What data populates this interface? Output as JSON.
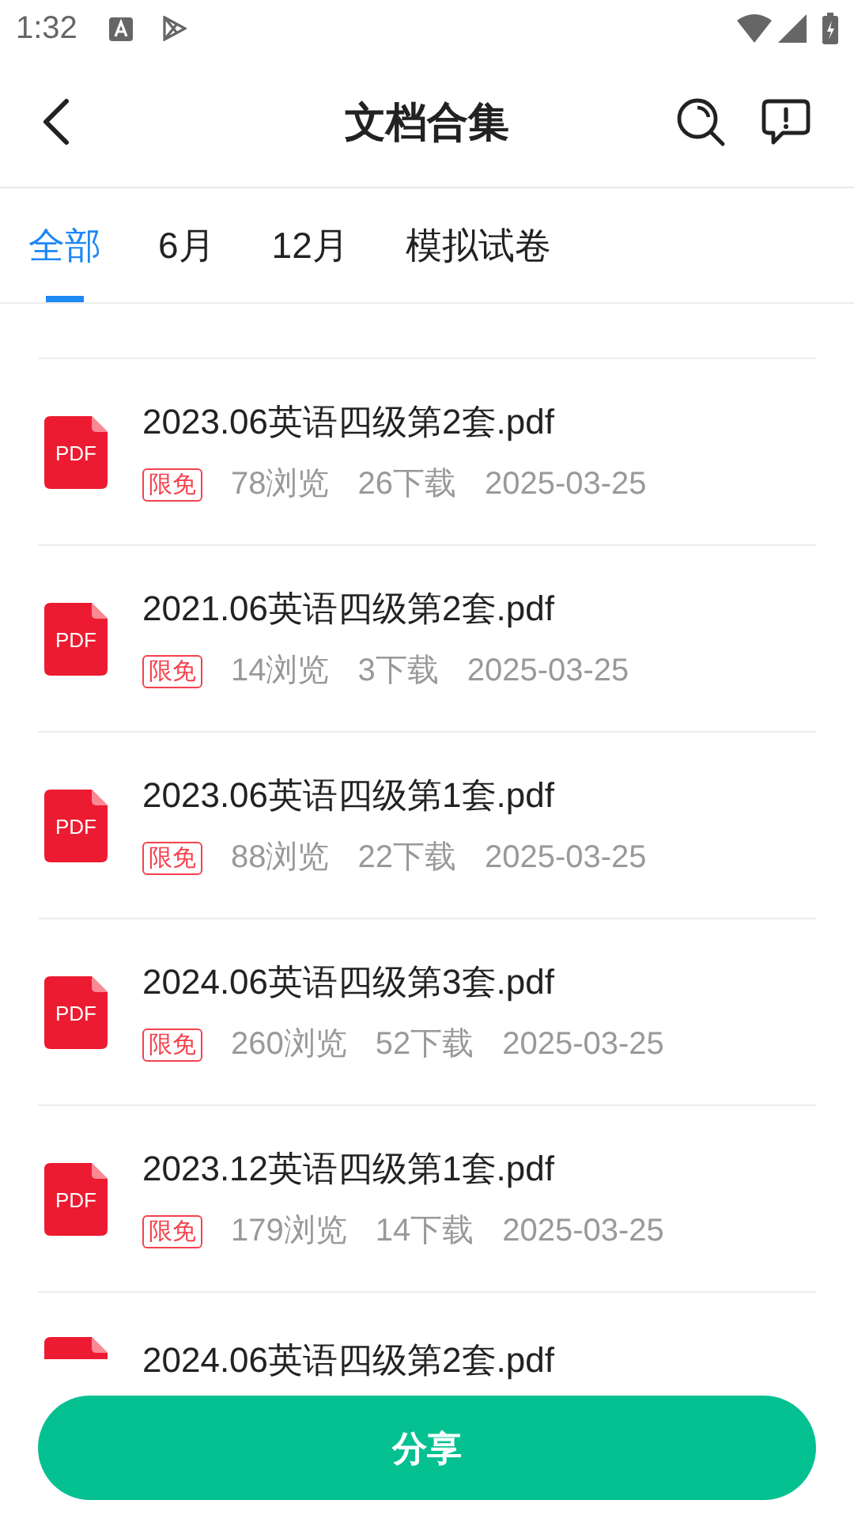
{
  "status_bar": {
    "time": "1:32"
  },
  "header": {
    "title": "文档合集"
  },
  "tabs": [
    {
      "label": "全部",
      "selected": true
    },
    {
      "label": "6月",
      "selected": false
    },
    {
      "label": "12月",
      "selected": false
    },
    {
      "label": "模拟试卷",
      "selected": false
    }
  ],
  "documents": [
    {
      "name": "2023.06英语四级第2套.pdf",
      "icon_label": "PDF",
      "badge": "限免",
      "views": "78浏览",
      "downloads": "26下载",
      "date": "2025-03-25"
    },
    {
      "name": "2021.06英语四级第2套.pdf",
      "icon_label": "PDF",
      "badge": "限免",
      "views": "14浏览",
      "downloads": "3下载",
      "date": "2025-03-25"
    },
    {
      "name": "2023.06英语四级第1套.pdf",
      "icon_label": "PDF",
      "badge": "限免",
      "views": "88浏览",
      "downloads": "22下载",
      "date": "2025-03-25"
    },
    {
      "name": "2024.06英语四级第3套.pdf",
      "icon_label": "PDF",
      "badge": "限免",
      "views": "260浏览",
      "downloads": "52下载",
      "date": "2025-03-25"
    },
    {
      "name": "2023.12英语四级第1套.pdf",
      "icon_label": "PDF",
      "badge": "限免",
      "views": "179浏览",
      "downloads": "14下载",
      "date": "2025-03-25"
    },
    {
      "name": "2024.06英语四级第2套.pdf"
    }
  ],
  "share_button": {
    "label": "分享"
  }
}
